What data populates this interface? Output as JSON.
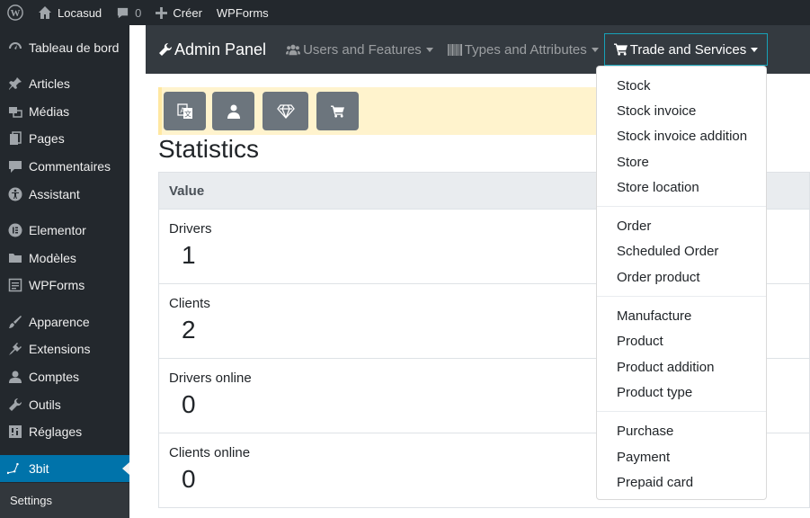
{
  "admin_bar": {
    "site_name": "Locasud",
    "comments_count": "0",
    "new_label": "Créer",
    "wpforms_label": "WPForms"
  },
  "sidebar": {
    "items": [
      {
        "label": "Tableau de bord",
        "icon": "dashboard-icon"
      },
      {
        "label": "Articles",
        "icon": "pin-icon"
      },
      {
        "label": "Médias",
        "icon": "media-icon"
      },
      {
        "label": "Pages",
        "icon": "pages-icon"
      },
      {
        "label": "Commentaires",
        "icon": "comment-icon"
      },
      {
        "label": "Assistant",
        "icon": "accessibility-icon"
      },
      {
        "label": "Elementor",
        "icon": "elementor-icon"
      },
      {
        "label": "Modèles",
        "icon": "folder-icon"
      },
      {
        "label": "WPForms",
        "icon": "form-icon"
      },
      {
        "label": "Apparence",
        "icon": "brush-icon"
      },
      {
        "label": "Extensions",
        "icon": "plugin-icon"
      },
      {
        "label": "Comptes",
        "icon": "user-icon"
      },
      {
        "label": "Outils",
        "icon": "wrench-icon"
      },
      {
        "label": "Réglages",
        "icon": "settings-icon"
      },
      {
        "label": "3bit",
        "icon": "graph-icon"
      }
    ],
    "submenu_label": "Settings"
  },
  "navbar": {
    "brand": "Admin Panel",
    "links": [
      {
        "label": "Users and Features"
      },
      {
        "label": "Types and Attributes"
      },
      {
        "label": "Trade and Services"
      }
    ]
  },
  "toolbar": {
    "buttons": [
      "translate-icon",
      "user-icon",
      "diamond-icon",
      "cart-icon"
    ]
  },
  "stats": {
    "title": "Statistics",
    "header": "Value",
    "rows": [
      {
        "label": "Drivers",
        "value": "1"
      },
      {
        "label": "Clients",
        "value": "2"
      },
      {
        "label": "Drivers online",
        "value": "0"
      },
      {
        "label": "Clients online",
        "value": "0"
      }
    ]
  },
  "dropdown": {
    "groups": [
      [
        "Stock",
        "Stock invoice",
        "Stock invoice addition",
        "Store",
        "Store location"
      ],
      [
        "Order",
        "Scheduled Order",
        "Order product"
      ],
      [
        "Manufacture",
        "Product",
        "Product addition",
        "Product type"
      ],
      [
        "Purchase",
        "Payment",
        "Prepaid card"
      ]
    ]
  },
  "colors": {
    "wp_dark": "#23282d",
    "wp_active": "#0073aa",
    "navbar": "#343a40",
    "alert": "#fff3cd",
    "button": "#6c757d"
  }
}
